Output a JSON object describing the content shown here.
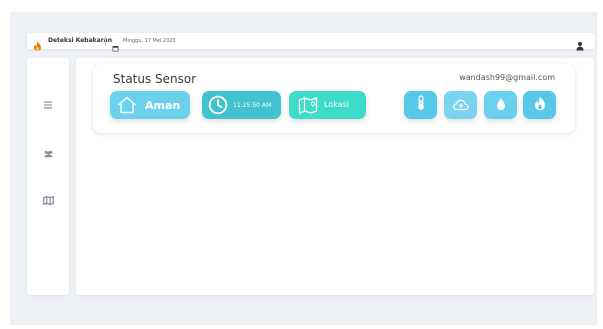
{
  "header": {
    "brand": "Deteksi Kebakaran",
    "date": "Minggu, 17 Mei 2020",
    "brand_icon": "fire-icon",
    "date_icon": "calendar-icon",
    "user_icon": "user-icon"
  },
  "sidebar": {
    "items": [
      {
        "icon": "menu-icon"
      },
      {
        "icon": "users-icon"
      },
      {
        "icon": "map-icon"
      }
    ]
  },
  "status_card": {
    "title": "Status Sensor",
    "email": "wandash99@gmail.com",
    "buttons": {
      "status": {
        "label": "Aman",
        "icon": "home-icon"
      },
      "time": {
        "label": "11:25:50 AM",
        "icon": "clock-icon"
      },
      "location": {
        "label": "Lokasi",
        "icon": "map-icon"
      }
    },
    "sensors": [
      {
        "icon": "thermometer-icon"
      },
      {
        "icon": "cloud-icon"
      },
      {
        "icon": "water-drop-icon"
      },
      {
        "icon": "fire-icon"
      }
    ]
  },
  "colors": {
    "background": "#edf0f5",
    "aman": "#6cd1ec",
    "time": "#42c1ce",
    "lokasi": "#3ddcca",
    "sensor": "#57c8e9",
    "brand_fire": "#f07a1a"
  }
}
